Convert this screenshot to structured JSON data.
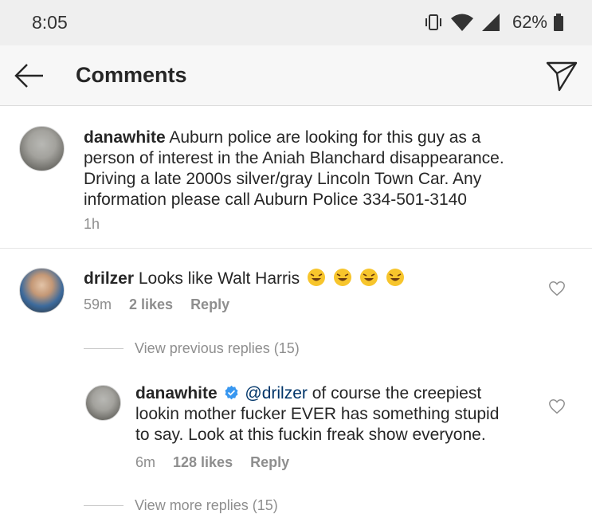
{
  "status_bar": {
    "time": "8:05",
    "battery": "62%"
  },
  "header": {
    "title": "Comments"
  },
  "caption": {
    "username": "danawhite",
    "text": "Auburn police are looking for this guy as a",
    "text_line2": "person of interest in the Aniah Blanchard disappearance.",
    "text_line3": "Driving a late 2000s silver/gray Lincoln Town Car. Any",
    "text_line4": "information please call Auburn Police 334-501-3140",
    "time": "1h"
  },
  "comment": {
    "username": "drilzer",
    "text": "Looks like Walt Harris",
    "emoji": "rolling-on-floor-laughing x4",
    "time": "59m",
    "likes": "2 likes",
    "reply_label": "Reply",
    "view_replies": "View previous replies (15)"
  },
  "reply": {
    "username": "danawhite",
    "mention": "@drilzer",
    "text_line1": "of course the creepiest",
    "text_line2": "lookin mother fucker EVER has something stupid",
    "text_line3": "to say. Look at this fuckin freak show everyone.",
    "time": "6m",
    "likes": "128 likes",
    "reply_label": "Reply",
    "view_more": "View more replies (15)"
  },
  "colors": {
    "link": "#003569",
    "verified": "#3897f0",
    "meta": "#8e8e8e",
    "emoji": "#f7c52c"
  }
}
